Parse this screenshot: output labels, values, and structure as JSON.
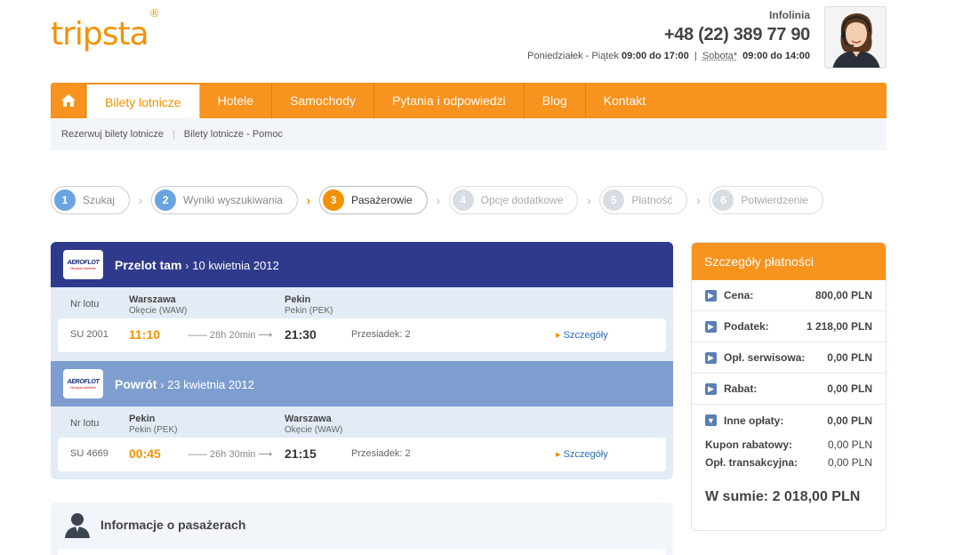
{
  "logo": "tripsta",
  "logo_reg": "®",
  "contact": {
    "label": "Infolinia",
    "phone": "+48 (22) 389 77 90",
    "weekdays": "Poniedziałek - Piątek",
    "weekdays_hours": "09:00 do 17:00",
    "saturday": "Sobota*",
    "saturday_hours": "09:00 do 14:00"
  },
  "nav": {
    "items": [
      "Bilety lotnicze",
      "Hotele",
      "Samochody",
      "Pytania i odpowiedzi",
      "Blog",
      "Kontakt"
    ]
  },
  "subnav": [
    "Rezerwuj bilety lotnicze",
    "Bilety lotnicze - Pomoc"
  ],
  "steps": [
    {
      "num": "1",
      "label": "Szukaj"
    },
    {
      "num": "2",
      "label": "Wyniki wyszukiwania"
    },
    {
      "num": "3",
      "label": "Pasażerowie"
    },
    {
      "num": "4",
      "label": "Opcje dodatkowe"
    },
    {
      "num": "5",
      "label": "Płatność"
    },
    {
      "num": "6",
      "label": "Potwierdzenie"
    }
  ],
  "outbound": {
    "airline": "AEROFLOT",
    "airline_sub": "Russian Airlines",
    "title": "Przelot tam",
    "date": "10 kwietnia 2012",
    "nr_label": "Nr lotu",
    "from_city": "Warszawa",
    "from_airport": "Okęcie (WAW)",
    "to_city": "Pekin",
    "to_airport": "Pekin (PEK)",
    "flight_no": "SU 2001",
    "dep": "11:10",
    "duration": "—— 28h 20min ⟶",
    "arr": "21:30",
    "stops": "Przesiadek: 2",
    "details": "Szczegóły"
  },
  "return": {
    "airline": "AEROFLOT",
    "airline_sub": "Russian Airlines",
    "title": "Powrót",
    "date": "23 kwietnia 2012",
    "nr_label": "Nr lotu",
    "from_city": "Pekin",
    "from_airport": "Pekin (PEK)",
    "to_city": "Warszawa",
    "to_airport": "Okęcie (WAW)",
    "flight_no": "SU 4669",
    "dep": "00:45",
    "duration": "—— 26h 30min ⟶",
    "arr": "21:15",
    "stops": "Przesiadek: 2",
    "details": "Szczegóły"
  },
  "passengers": {
    "title": "Informacje o pasażerach"
  },
  "payment": {
    "title": "Szczegóły płatności",
    "rows": [
      {
        "label": "Cena:",
        "value": "800,00 PLN"
      },
      {
        "label": "Podatek:",
        "value": "1 218,00 PLN"
      },
      {
        "label": "Opł. serwisowa:",
        "value": "0,00 PLN"
      },
      {
        "label": "Rabat:",
        "value": "0,00 PLN"
      },
      {
        "label": "Inne opłaty:",
        "value": "0,00 PLN"
      }
    ],
    "sub": [
      {
        "label": "Kupon rabatowy:",
        "value": "0,00 PLN"
      },
      {
        "label": "Opł. transakcyjna:",
        "value": "0,00 PLN"
      }
    ],
    "total": "W sumie: 2 018,00 PLN"
  },
  "colors": {
    "accent": "#f7931e",
    "navy": "#2f3a8c",
    "light_blue": "#7e9ed0",
    "link": "#2a6db5"
  }
}
